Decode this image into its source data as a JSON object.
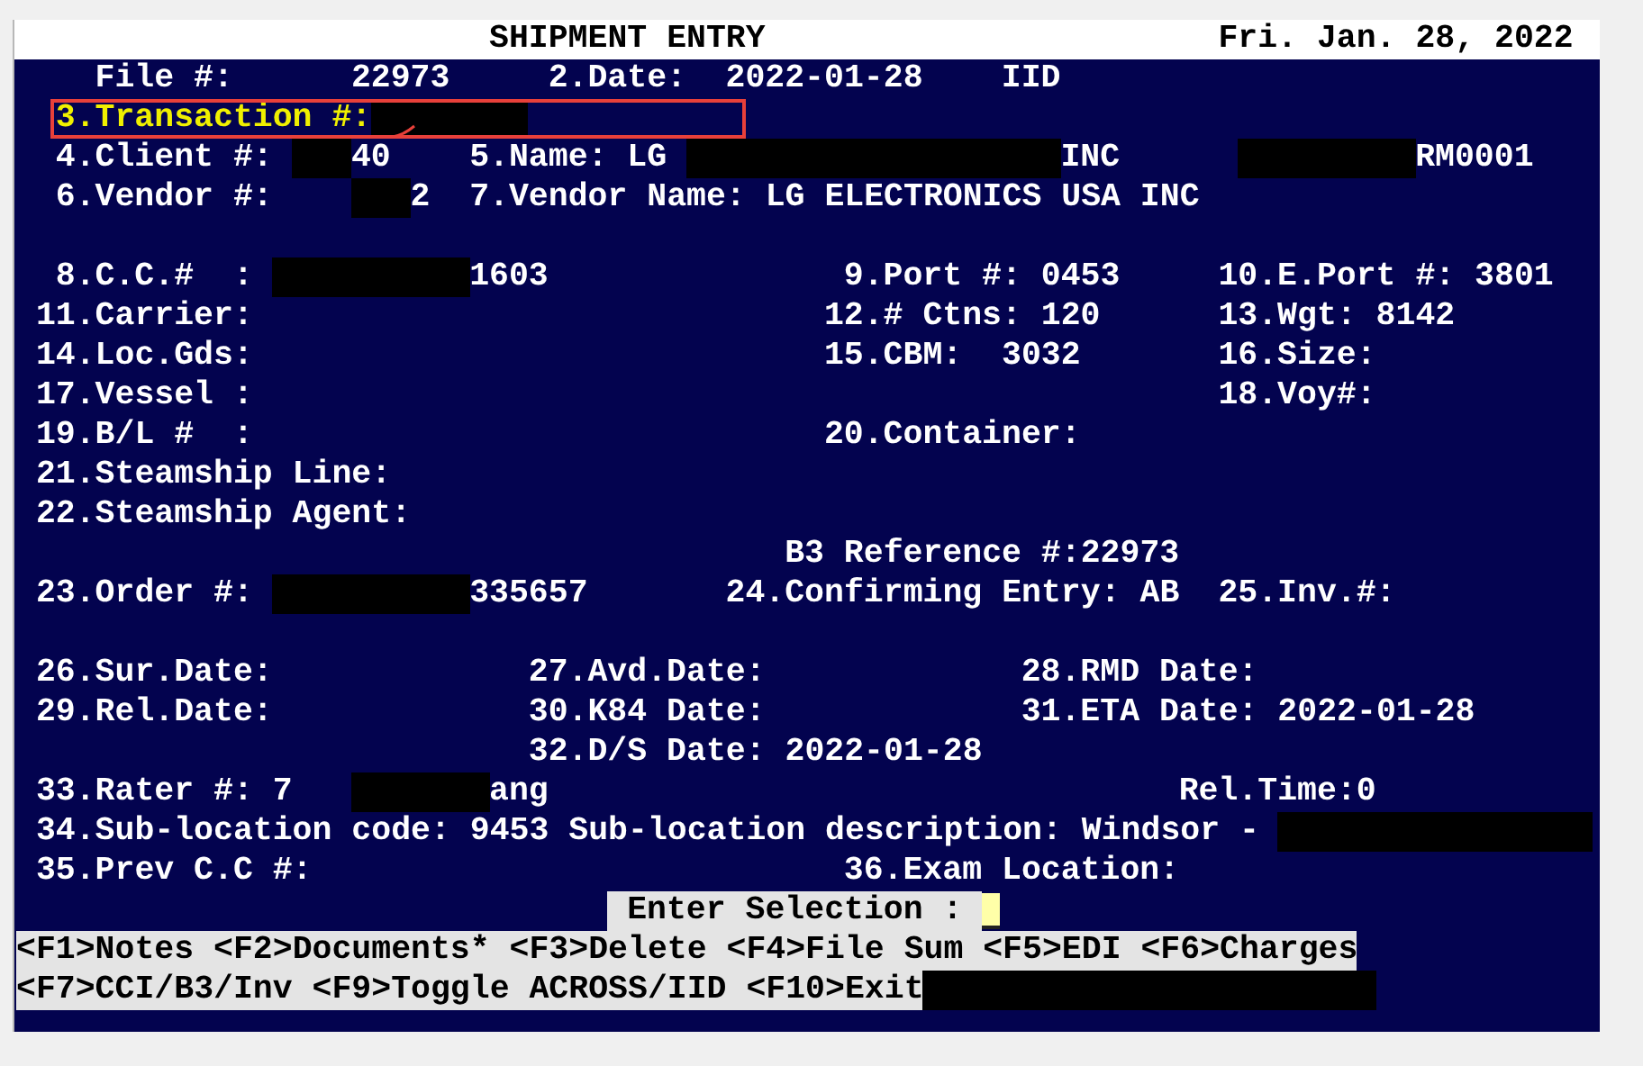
{
  "header": {
    "title": "SHIPMENT ENTRY",
    "date": "Fri. Jan. 28, 2022"
  },
  "lines": [
    {
      "items": [
        {
          "kind": "text",
          "text": "File #:"
        },
        {
          "kind": "text",
          "text": "22973"
        },
        {
          "kind": "text",
          "text": "2.Date:"
        },
        {
          "kind": "text",
          "text": "2022-01-28"
        },
        {
          "kind": "text",
          "text": "IID"
        }
      ]
    },
    {
      "items": [
        {
          "kind": "current",
          "text": "3.Transaction #:"
        },
        {
          "kind": "redacted"
        }
      ]
    },
    {
      "items": [
        {
          "kind": "text",
          "text": "4.Client #:"
        },
        {
          "kind": "redacted"
        },
        {
          "kind": "text",
          "text": "40"
        },
        {
          "kind": "text",
          "text": "5.Name: LG"
        },
        {
          "kind": "redacted"
        },
        {
          "kind": "text",
          "text": "INC"
        },
        {
          "kind": "redacted"
        },
        {
          "kind": "text",
          "text": "RM0001"
        }
      ]
    },
    {
      "items": [
        {
          "kind": "text",
          "text": "6.Vendor #:"
        },
        {
          "kind": "redacted"
        },
        {
          "kind": "text",
          "text": "2"
        },
        {
          "kind": "text",
          "text": "7.Vendor Name: LG ELECTRONICS USA INC"
        }
      ]
    },
    {
      "items": [
        {
          "kind": "text",
          "text": "8.C.C.#  :"
        },
        {
          "kind": "redacted"
        },
        {
          "kind": "text",
          "text": "1603"
        },
        {
          "kind": "text",
          "text": "9.Port #: 0453"
        },
        {
          "kind": "text",
          "text": "10.E.Port #: 3801"
        }
      ]
    },
    {
      "items": [
        {
          "kind": "text",
          "text": "11.Carrier:"
        },
        {
          "kind": "text",
          "text": "12.# Ctns: 120"
        },
        {
          "kind": "text",
          "text": "13.Wgt: 8142"
        }
      ]
    },
    {
      "items": [
        {
          "kind": "text",
          "text": "14.Loc.Gds:"
        },
        {
          "kind": "text",
          "text": "15.CBM:  3032"
        },
        {
          "kind": "text",
          "text": "16.Size:"
        }
      ]
    },
    {
      "items": [
        {
          "kind": "text",
          "text": "17.Vessel :"
        },
        {
          "kind": "text",
          "text": "18.Voy#:"
        }
      ]
    },
    {
      "items": [
        {
          "kind": "text",
          "text": "19.B/L #  :"
        },
        {
          "kind": "text",
          "text": "20.Container:"
        }
      ]
    },
    {
      "items": [
        {
          "kind": "text",
          "text": "21.Steamship Line:"
        }
      ]
    },
    {
      "items": [
        {
          "kind": "text",
          "text": "22.Steamship Agent:"
        }
      ]
    },
    {
      "items": [
        {
          "kind": "text",
          "text": "B3 Reference #:22973"
        }
      ]
    },
    {
      "items": [
        {
          "kind": "text",
          "text": "23.Order #:"
        },
        {
          "kind": "redacted"
        },
        {
          "kind": "text",
          "text": "335657"
        },
        {
          "kind": "text",
          "text": "24.Confirming Entry: AB"
        },
        {
          "kind": "text",
          "text": "25.Inv.#:"
        }
      ]
    },
    {
      "items": [
        {
          "kind": "text",
          "text": "26.Sur.Date:"
        },
        {
          "kind": "text",
          "text": "27.Avd.Date:"
        },
        {
          "kind": "text",
          "text": "28.RMD Date:"
        }
      ]
    },
    {
      "items": [
        {
          "kind": "text",
          "text": "29.Rel.Date:"
        },
        {
          "kind": "text",
          "text": "30.K84 Date:"
        },
        {
          "kind": "text",
          "text": "31.ETA Date: 2022-01-28"
        }
      ]
    },
    {
      "items": [
        {
          "kind": "text",
          "text": "32.D/S Date: 2022-01-28"
        }
      ]
    },
    {
      "items": [
        {
          "kind": "text",
          "text": "33.Rater #: 7"
        },
        {
          "kind": "redacted"
        },
        {
          "kind": "text",
          "text": "ang"
        },
        {
          "kind": "text",
          "text": "Rel.Time:0"
        }
      ]
    },
    {
      "items": [
        {
          "kind": "text",
          "text": "34.Sub-location code: 9453 Sub-location description: Windsor -"
        },
        {
          "kind": "redacted"
        }
      ]
    },
    {
      "items": [
        {
          "kind": "text",
          "text": "35.Prev C.C #:"
        },
        {
          "kind": "text",
          "text": "36.Exam Location:"
        }
      ]
    }
  ],
  "annotation": {
    "box": true,
    "scribble": true
  },
  "prompt": {
    "text": "Enter Selection :"
  },
  "function_keys": [
    {
      "keys": [
        "<F1>Notes",
        "<F2>Documents*",
        "<F3>Delete",
        "<F4>File Sum",
        "<F5>EDI",
        "<F6>Charges"
      ],
      "redacted_tail": false
    },
    {
      "keys": [
        "<F7>CCI/B3/Inv",
        "<F9>Toggle ACROSS/IID",
        "<F10>Exit"
      ],
      "redacted_tail": true
    }
  ]
}
